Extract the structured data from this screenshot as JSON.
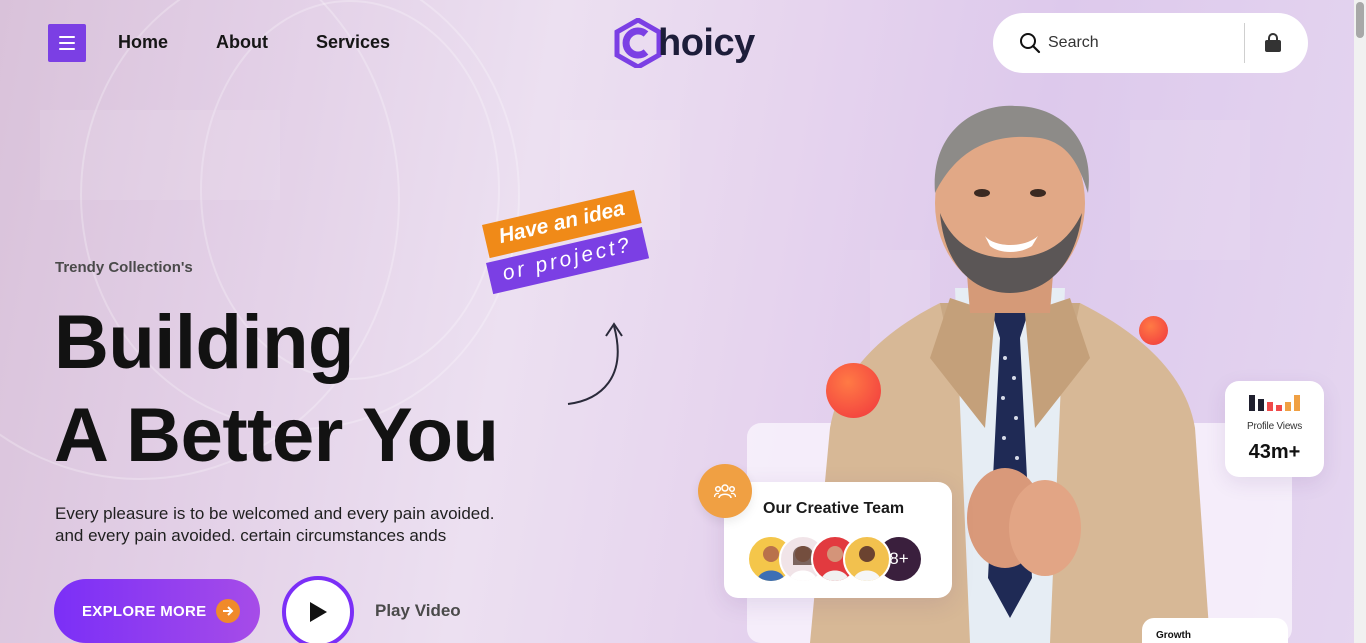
{
  "nav": {
    "menu_icon": "hamburger-icon",
    "links": [
      "Home",
      "About",
      "Services"
    ]
  },
  "brand": {
    "name_rest": "hoicy",
    "accent_color": "#7b3fe4"
  },
  "search": {
    "placeholder": "Search",
    "icon": "search-icon",
    "cart_icon": "shopping-bag-icon"
  },
  "hero": {
    "kicker": "Trendy Collection's",
    "title_line1": "Building",
    "title_line2": "A Better You",
    "desc_line1": "Every pleasure is to be welcomed and every pain avoided.",
    "desc_line2": "and every pain avoided. certain circumstances ands",
    "explore_label": "EXPLORE MORE",
    "play_label": "Play Video"
  },
  "sticker": {
    "line1": "Have an idea",
    "line2": "or project?",
    "line1_color": "#f08a18",
    "line2_color": "#7b3fe4"
  },
  "profile_views": {
    "label": "Profile Views",
    "value": "43m+"
  },
  "team": {
    "title": "Our Creative Team",
    "more": "8+"
  },
  "growth": {
    "label": "Growth"
  }
}
